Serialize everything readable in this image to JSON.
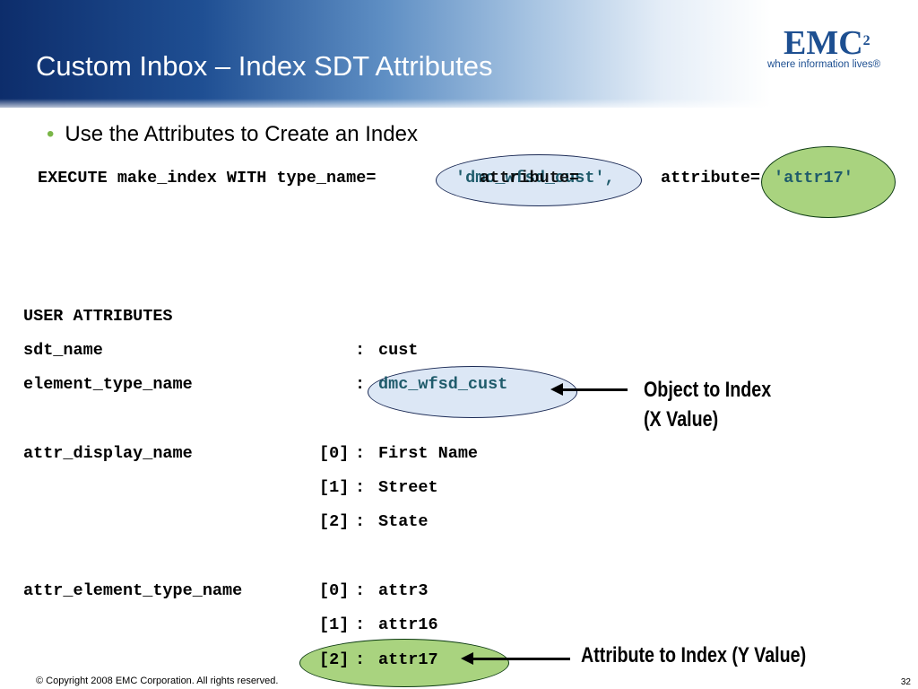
{
  "slide": {
    "title": "Custom Inbox – Index SDT Attributes",
    "logo": {
      "wordmark": "EMC",
      "superscript": "2",
      "tagline": "where information lives®"
    },
    "bullet": "Use the Attributes to Create an Index",
    "command_prefix": "EXECUTE make_index WITH type_name=",
    "command_overlap_a": "'dmc_wfsd_cust',",
    "command_overlap_b": "attribute=",
    "command_attr_value": "'attr17'",
    "attributes": {
      "header": "USER ATTRIBUTES",
      "rows": [
        {
          "name": "sdt_name",
          "index": "",
          "value": "cust"
        },
        {
          "name": "element_type_name",
          "index": "",
          "value": "dmc_wfsd_cust"
        },
        {
          "name": "attr_display_name",
          "index": "[0]",
          "value": "First Name"
        },
        {
          "name": "",
          "index": "[1]",
          "value": "Street"
        },
        {
          "name": "",
          "index": "[2]",
          "value": "State"
        },
        {
          "name": "attr_element_type_name",
          "index": "[0]",
          "value": "attr3"
        },
        {
          "name": "",
          "index": "[1]",
          "value": "attr16"
        },
        {
          "name": "",
          "index": "[2]",
          "value": "attr17"
        }
      ]
    },
    "callouts": {
      "object_line1": "Object to Index",
      "object_line2": "(X Value)",
      "attribute": "Attribute to Index (Y Value)"
    },
    "footer": "© Copyright 2008 EMC Corporation. All rights reserved.",
    "page_number": "32",
    "colors": {
      "header_dark": "#0d2d6b",
      "bullet_dot": "#7ab648",
      "blue_ellipse": "#dce7f5",
      "green_ellipse": "#a9d37f",
      "logo": "#1d4f91"
    }
  }
}
